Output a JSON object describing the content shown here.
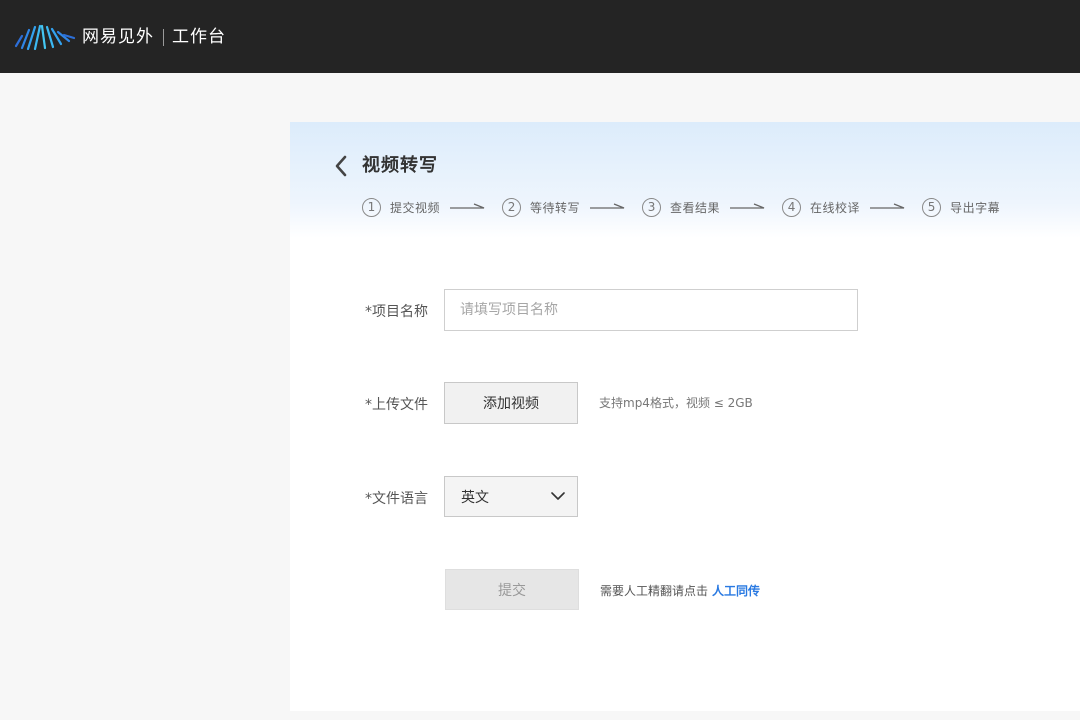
{
  "header": {
    "brand": "网易见外",
    "workspace": "工作台",
    "logo_icon": "waveform-logo-icon",
    "background": "#242424"
  },
  "page": {
    "title": "视频转写",
    "back_icon": "chevron-left-icon"
  },
  "steps": [
    {
      "num": "1",
      "label": "提交视频"
    },
    {
      "num": "2",
      "label": "等待转写"
    },
    {
      "num": "3",
      "label": "查看结果"
    },
    {
      "num": "4",
      "label": "在线校译"
    },
    {
      "num": "5",
      "label": "导出字幕"
    }
  ],
  "form": {
    "project_name": {
      "label": "*项目名称",
      "value": "",
      "placeholder": "请填写项目名称"
    },
    "upload": {
      "label": "*上传文件",
      "button": "添加视频",
      "hint": "支持mp4格式，视频 ≤ 2GB"
    },
    "language": {
      "label": "*文件语言",
      "value": "英文",
      "icon": "chevron-down-icon"
    },
    "submit": {
      "button": "提交",
      "note": "需要人工精翻请点击",
      "link": "人工同传"
    }
  },
  "colors": {
    "accent": "#2a7ae2",
    "header_gradient_top": "#dcecfb"
  }
}
